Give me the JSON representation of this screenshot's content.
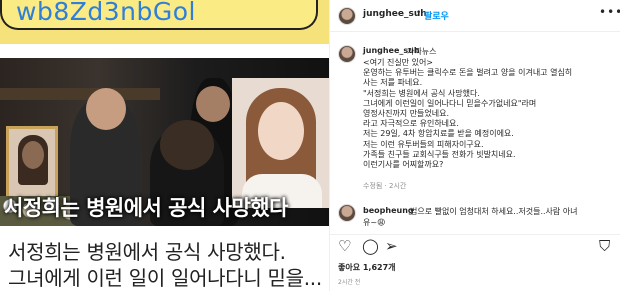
{
  "post_image": {
    "code_text": "wb8Zd3nbGol",
    "overlay_caption": "서정희는 병원에서 공식 사망했다",
    "caption_line1": "서정희는 병원에서 공식 사망했다.",
    "caption_line2": "그녀에게 이런 일이 일어나다니 믿을..."
  },
  "header": {
    "username": "junghee_suh",
    "separator": "•",
    "follow_label": "팔로우",
    "more_label": "•••"
  },
  "post": {
    "username": "junghee_suh",
    "tag": "가짜뉴스",
    "lines": [
      "<여기 진실만 있어>",
      "운영하는 유투버는 클릭수로 돈을 벌려고 양을 이겨내고 열심히",
      "사는 저를 파네요.",
      "\"서정희는 병원에서 공식 사망했다.",
      "그녀에게 이런일이 일어나다니 믿을수가없네요\"라며",
      "영정사진까지 만들었네요.",
      "라고 자극적으로 유인하네요.",
      "저는 29일, 4차 항암치료를 받을 예정이에요.",
      "저는 이런 유투버들의 피해자이구요.",
      "가족들 친구들 교회식구들 전화가 빗발치네요.",
      "이런기사를 어찌할까요?"
    ],
    "meta": "수정됨 · 2시간"
  },
  "comment": {
    "username": "beopheung",
    "text": "법으로 빨없이 엄청대처 하세요..저것들..사람 아녀",
    "text2": "유~😩"
  },
  "actions": {
    "heart_icon": "♡",
    "comment_icon": "◯",
    "share_icon": "➢",
    "bookmark_icon": "⛉"
  },
  "likes": "좋아요 1,627개",
  "time_ago": "2시간 전"
}
